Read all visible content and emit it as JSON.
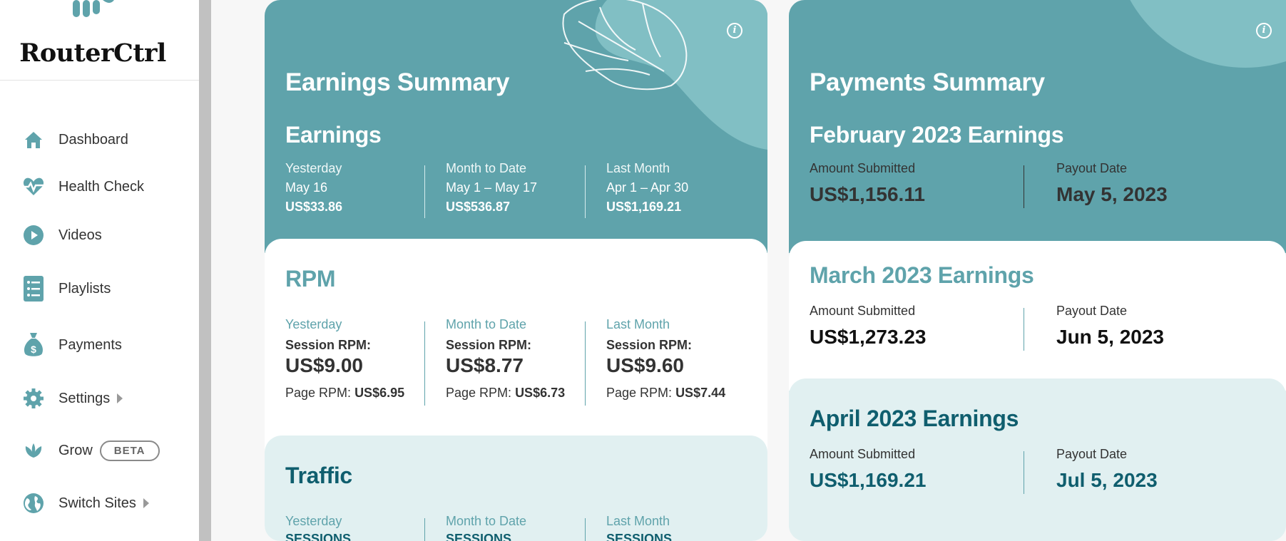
{
  "brand": {
    "name": "RouterCtrl"
  },
  "sidebar": {
    "items": [
      {
        "label": "Dashboard",
        "icon": "house-icon"
      },
      {
        "label": "Health Check",
        "icon": "heartbeat-icon"
      },
      {
        "label": "Videos",
        "icon": "play-icon"
      },
      {
        "label": "Playlists",
        "icon": "checklist-icon"
      },
      {
        "label": "Payments",
        "icon": "money-bag-icon"
      },
      {
        "label": "Settings",
        "icon": "gear-icon"
      },
      {
        "label": "Grow",
        "icon": "leaf-icon",
        "badge": "BETA"
      },
      {
        "label": "Switch Sites",
        "icon": "globe-icon"
      }
    ]
  },
  "earnings": {
    "title": "Earnings Summary",
    "subtitle": "Earnings",
    "columns": [
      {
        "label": "Yesterday",
        "range": "May 16",
        "amount": "US$33.86"
      },
      {
        "label": "Month to Date",
        "range": "May 1 – May 17",
        "amount": "US$536.87"
      },
      {
        "label": "Last Month",
        "range": "Apr 1 – Apr 30",
        "amount": "US$1,169.21"
      }
    ]
  },
  "rpm": {
    "title": "RPM",
    "session_label": "Session RPM:",
    "page_label": "Page RPM:",
    "columns": [
      {
        "label": "Yesterday",
        "session": "US$9.00",
        "page": "US$6.95"
      },
      {
        "label": "Month to Date",
        "session": "US$8.77",
        "page": "US$6.73"
      },
      {
        "label": "Last Month",
        "session": "US$9.60",
        "page": "US$7.44"
      }
    ]
  },
  "traffic": {
    "title": "Traffic",
    "columns": [
      {
        "label": "Yesterday",
        "metric": "SESSIONS"
      },
      {
        "label": "Month to Date",
        "metric": "SESSIONS"
      },
      {
        "label": "Last Month",
        "metric": "SESSIONS"
      }
    ]
  },
  "payments": {
    "title": "Payments Summary",
    "amount_label": "Amount Submitted",
    "payout_label": "Payout Date",
    "periods": [
      {
        "title": "February 2023 Earnings",
        "amount": "US$1,156.11",
        "payout": "May 5, 2023"
      },
      {
        "title": "March 2023 Earnings",
        "amount": "US$1,273.23",
        "payout": "Jun 5, 2023"
      },
      {
        "title": "April 2023 Earnings",
        "amount": "US$1,169.21",
        "payout": "Jul 5, 2023"
      }
    ]
  },
  "colors": {
    "teal": "#5fa3ab",
    "dark_teal": "#0f5e6e",
    "light_teal": "#e1f0f1",
    "text": "#333333"
  }
}
